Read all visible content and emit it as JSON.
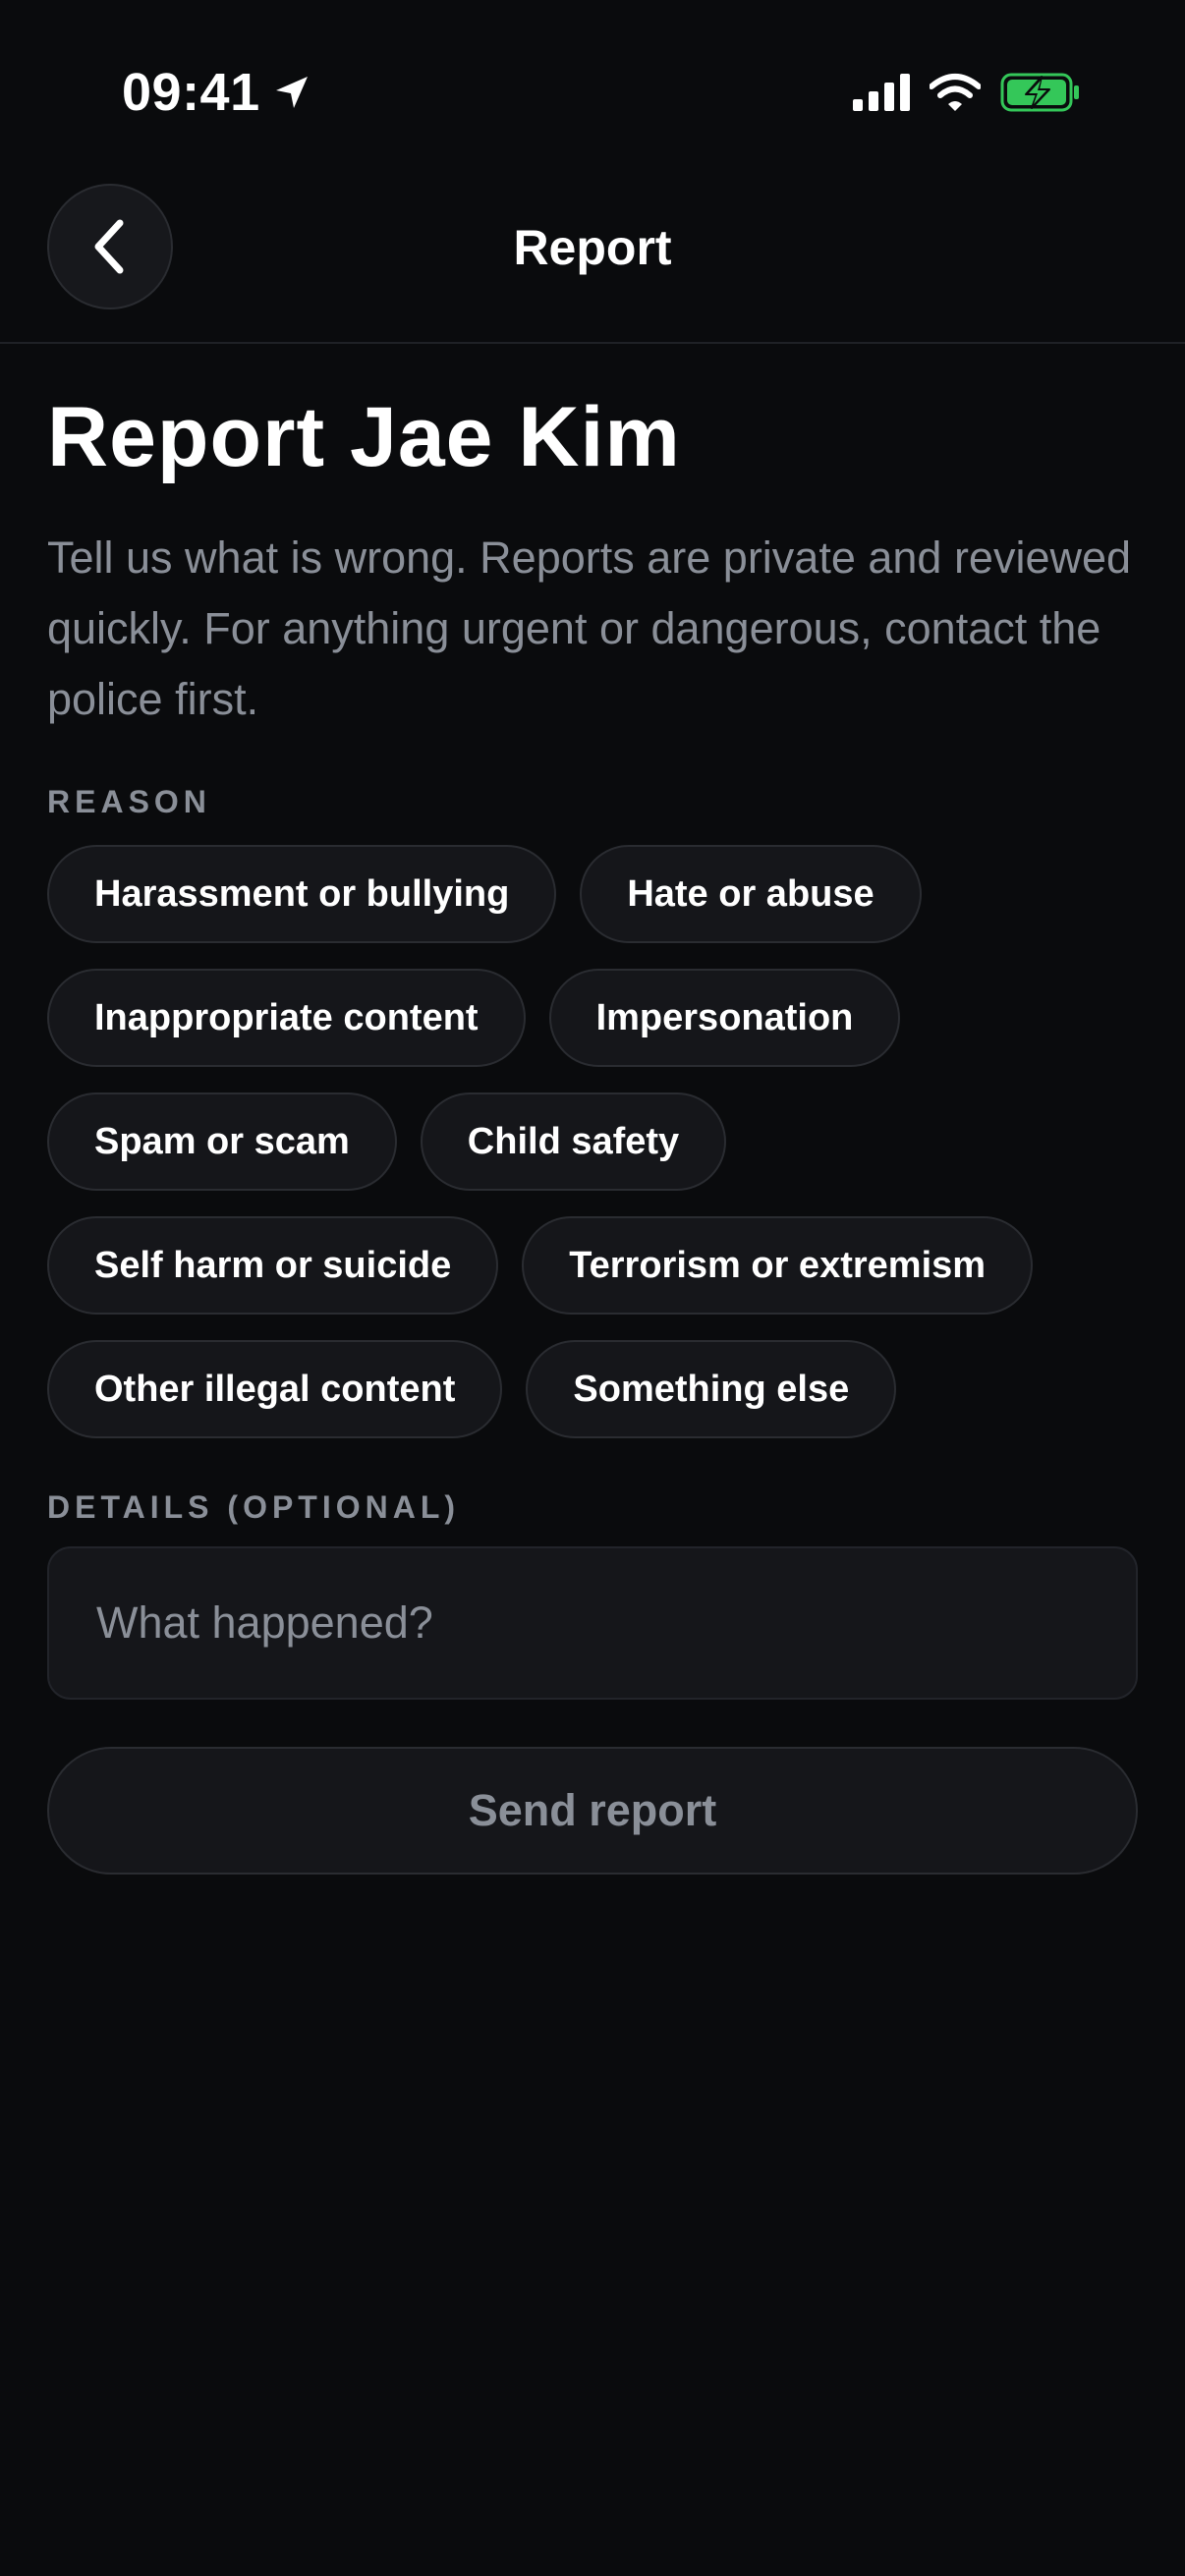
{
  "status_bar": {
    "time": "09:41",
    "icons": [
      "location-arrow-icon",
      "cellular-signal-icon",
      "wifi-icon",
      "battery-charging-icon"
    ],
    "battery_color": "#34c759"
  },
  "header": {
    "title": "Report",
    "back_icon": "chevron-left-icon"
  },
  "main": {
    "title": "Report Jae Kim",
    "description": "Tell us what is wrong. Reports are private and reviewed quickly. For anything urgent or dangerous, contact the police first.",
    "reason_label": "REASON",
    "reasons": [
      "Harassment or bullying",
      "Hate or abuse",
      "Inappropriate content",
      "Impersonation",
      "Spam or scam",
      "Child safety",
      "Self harm or suicide",
      "Terrorism or extremism",
      "Other illegal content",
      "Something else"
    ],
    "details_label": "DETAILS (OPTIONAL)",
    "details_value": "",
    "details_placeholder": "What happened?",
    "send_label": "Send report"
  },
  "colors": {
    "background": "#0a0b0d",
    "surface": "#15161a",
    "border": "#2a2c31",
    "muted_text": "#8a8f98",
    "text": "#ffffff"
  }
}
